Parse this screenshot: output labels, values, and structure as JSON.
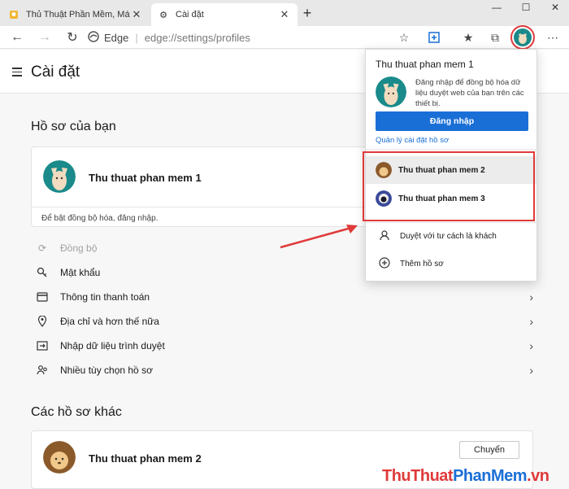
{
  "tabs": [
    {
      "title": "Thủ Thuật Phần Mềm, Máy Tính,",
      "icon": "bulb-icon"
    },
    {
      "title": "Cài đặt",
      "icon": "gear-icon"
    }
  ],
  "address": {
    "brand": "Edge",
    "url": "edge://settings/profiles"
  },
  "settings": {
    "title": "Cài đặt"
  },
  "profiles_section": {
    "title": "Hồ sơ của bạn",
    "current_profile": "Thu thuat phan mem 1",
    "sync_hint": "Để bật đồng bộ hóa, đăng nhập."
  },
  "menu_items": [
    {
      "label": "Đồng bộ",
      "icon": "sync-icon",
      "enabled": false
    },
    {
      "label": "Mật khẩu",
      "icon": "key-icon",
      "enabled": true
    },
    {
      "label": "Thông tin thanh toán",
      "icon": "card-icon",
      "enabled": true
    },
    {
      "label": "Địa chỉ và hơn thế nữa",
      "icon": "location-icon",
      "enabled": true
    },
    {
      "label": "Nhập dữ liệu trình duyệt",
      "icon": "import-icon",
      "enabled": true
    },
    {
      "label": "Nhiều tùy chọn hồ sơ",
      "icon": "people-icon",
      "enabled": true
    }
  ],
  "other_profiles": {
    "title": "Các hồ sơ khác",
    "profile_name": "Thu thuat phan mem 2",
    "switch_label": "Chuyển"
  },
  "flyout": {
    "name": "Thu thuat phan mem 1",
    "description": "Đăng nhập để đồng bộ hóa dữ liệu duyệt web của bạn trên các thiết bị.",
    "signin_label": "Đăng nhập",
    "manage_label": "Quản lý cài đặt hồ sơ",
    "profiles": [
      "Thu thuat phan mem 2",
      "Thu thuat phan mem 3"
    ],
    "guest_label": "Duyệt với tư cách là khách",
    "add_label": "Thêm hồ sơ"
  },
  "watermark": {
    "part1": "ThuThuat",
    "part2": "PhanMem",
    "part3": ".vn"
  },
  "colors": {
    "accent": "#1a6fd6",
    "highlight": "#e03a3a",
    "teal": "#1a8a8a"
  }
}
